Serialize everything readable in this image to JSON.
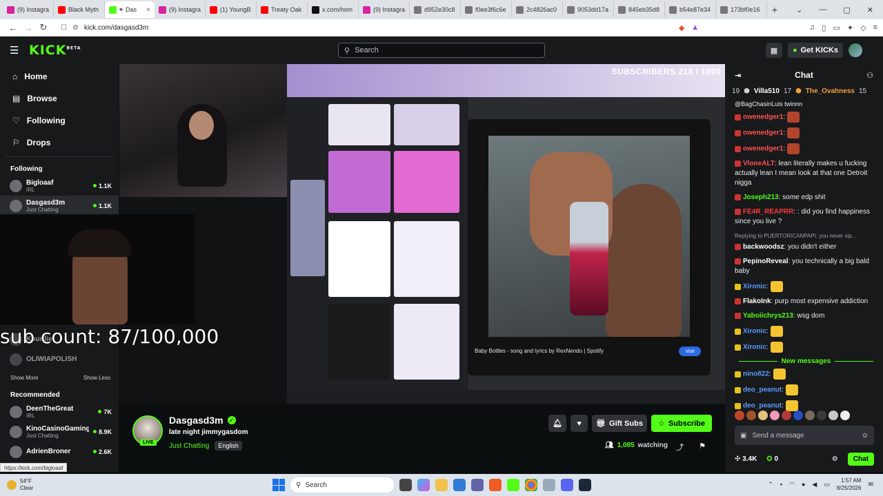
{
  "browser": {
    "tabs": [
      {
        "label": "(9) Instagra",
        "color": "#d6249f"
      },
      {
        "label": "Black Myth",
        "color": "#ff0000"
      },
      {
        "label": "Das",
        "color": "#53fc18",
        "active": true
      },
      {
        "label": "(9) Instagra",
        "color": "#d6249f"
      },
      {
        "label": "(1) YoungB",
        "color": "#ff0000"
      },
      {
        "label": "Treaty Oak",
        "color": "#ff0000"
      },
      {
        "label": "x.com/hom",
        "color": "#111111"
      },
      {
        "label": "(9) Instagra",
        "color": "#d6249f"
      },
      {
        "label": "d952e30c8",
        "color": "#777777"
      },
      {
        "label": "f0ee3f6c6e",
        "color": "#777777"
      },
      {
        "label": "2c4826ac0",
        "color": "#777777"
      },
      {
        "label": "9053dd17a",
        "color": "#777777"
      },
      {
        "label": "845eb35d8",
        "color": "#777777"
      },
      {
        "label": "b54e87e34",
        "color": "#777777"
      },
      {
        "label": "173bf0e16",
        "color": "#777777"
      }
    ],
    "url": "kick.com/dasgasd3m"
  },
  "topbar": {
    "logo": "KICK",
    "logo_sup": "BETA",
    "search_placeholder": "Search",
    "get_kicks": "Get KICKs"
  },
  "sidebar": {
    "nav": [
      {
        "label": "Home",
        "icon": "home-icon",
        "glyph": "⌂"
      },
      {
        "label": "Browse",
        "icon": "browse-icon",
        "glyph": "▤"
      },
      {
        "label": "Following",
        "icon": "heart-icon",
        "glyph": "♡"
      },
      {
        "label": "Drops",
        "icon": "drops-icon",
        "glyph": "⚐"
      }
    ],
    "following_header": "Following",
    "following": [
      {
        "name": "Bigloaaf",
        "category": "IRL",
        "viewers": "1.1K"
      },
      {
        "name": "Dasgasd3m",
        "category": "Just Chatting",
        "viewers": "1.1K"
      }
    ],
    "offline": [
      "Kourtlie",
      "OLIWIAPOLISH"
    ],
    "show_more": "Show More",
    "show_less": "Show Less",
    "recommended_header": "Recommended",
    "recommended": [
      {
        "name": "DeenTheGreat",
        "category": "IRL",
        "viewers": "7K"
      },
      {
        "name": "KinoCasinoGaming",
        "category": "Just Chatting",
        "viewers": "8.9K"
      },
      {
        "name": "AdrienBroner",
        "category": "",
        "viewers": "2.6K"
      }
    ]
  },
  "video": {
    "overlay_subscribers": "SUBSCRIBERS 218 / 1000",
    "sub_count": "sub count: 87/100,000",
    "spotify_caption": "Baby Bottles - song and lyrics by RexNendo | Spotify",
    "visit": "Visit"
  },
  "stream": {
    "streamer": "Dasgasd3m",
    "title": "late night jimmygasdom",
    "category": "Just Chatting",
    "language": "English",
    "live": "LIVE",
    "gift_subs": "Gift Subs",
    "subscribe": "Subscribe",
    "watching_count": "1,085",
    "watching_label": "watching"
  },
  "chat": {
    "title": "Chat",
    "pinned": [
      {
        "rank": "19",
        "name": "Villa510",
        "count": "17"
      },
      {
        "name": "The_Ovahness",
        "count": "15"
      }
    ],
    "top_line": "@BagChasinLuis twinnn",
    "messages": [
      {
        "user": "owenedger1",
        "color": "#ff5252",
        "text": ":",
        "emote": true
      },
      {
        "user": "owenedger1",
        "color": "#ff5252",
        "text": ":",
        "emote": true
      },
      {
        "user": "owenedger1",
        "color": "#ff5252",
        "text": ":",
        "emote": true
      },
      {
        "user": "VloneALT",
        "color": "#ff5252",
        "text": ": lean literally makes u fucking actually lean I mean look at that one Detroit nigga"
      },
      {
        "user": "Joseph213",
        "color": "#53fc18",
        "text": ": some edp shit"
      },
      {
        "user": "FE4R_REAPRR",
        "color": "#ff3b3b",
        "text": ": : did you find happiness since you live ?"
      },
      {
        "reply": "Replying to PUERTORICANPAPI: you never sip..."
      },
      {
        "user": "backwoodsz",
        "color": "#ffffff",
        "text": ": you didn't either"
      },
      {
        "user": "PepinoReveal",
        "color": "#ffffff",
        "text": ": you technically a big bald baby"
      },
      {
        "user": "Xironic",
        "color": "#5b9bff",
        "text": ":",
        "emote": true
      },
      {
        "user": "FlakoInk",
        "color": "#ffffff",
        "text": ": purp most expensive addiction"
      },
      {
        "user": "Yaboiichrys213",
        "color": "#53fc18",
        "text": ": wsg dom"
      },
      {
        "user": "Xironic",
        "color": "#5b9bff",
        "text": ":",
        "emote": true
      },
      {
        "user": "Xironic",
        "color": "#5b9bff",
        "text": ":",
        "emote": true
      }
    ],
    "new_messages": "New messages",
    "after": [
      {
        "user": "nino822",
        "color": "#5b9bff",
        "text": ":",
        "emote": true
      },
      {
        "user": "deo_peanut",
        "color": "#5b9bff",
        "text": ":",
        "emote": true
      },
      {
        "user": "deo_peanut",
        "color": "#5b9bff",
        "text": ":",
        "emote": true
      }
    ],
    "input_placeholder": "Send a message",
    "kicks": "3.4K",
    "points": "0",
    "chat_button": "Chat"
  },
  "statusbar": "https://kick.com/bigloaaf",
  "taskbar": {
    "temp": "54°F",
    "weather": "Clear",
    "search": "Search",
    "time": "1:57 AM",
    "date": "8/25/2026"
  }
}
